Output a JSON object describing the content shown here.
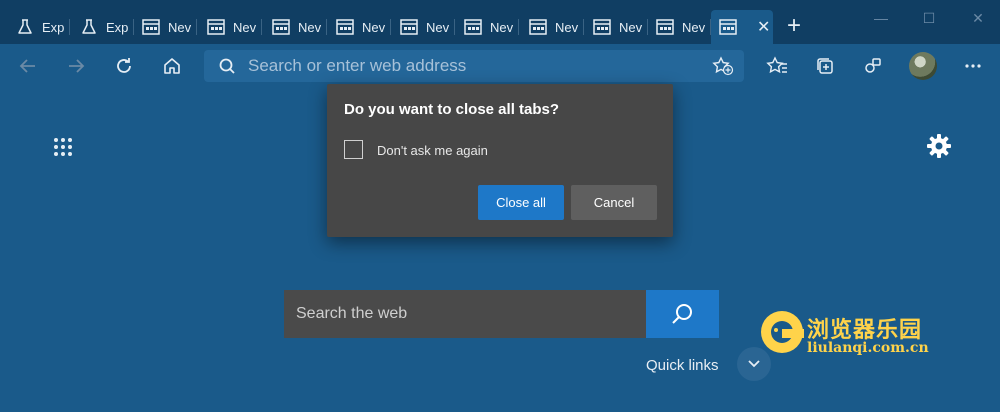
{
  "tabs": [
    {
      "title": "Exp",
      "icon": "flask-icon"
    },
    {
      "title": "Exp",
      "icon": "flask-icon"
    },
    {
      "title": "Nev",
      "icon": "new-tab-icon"
    },
    {
      "title": "Nev",
      "icon": "new-tab-icon"
    },
    {
      "title": "Nev",
      "icon": "new-tab-icon"
    },
    {
      "title": "Nev",
      "icon": "new-tab-icon"
    },
    {
      "title": "Nev",
      "icon": "new-tab-icon"
    },
    {
      "title": "Nev",
      "icon": "new-tab-icon"
    },
    {
      "title": "Nev",
      "icon": "new-tab-icon"
    },
    {
      "title": "Nev",
      "icon": "new-tab-icon"
    },
    {
      "title": "Nev",
      "icon": "new-tab-icon"
    }
  ],
  "window_controls": {
    "minimize": "—",
    "maximize": "☐",
    "close": "✕"
  },
  "address_bar": {
    "placeholder": "Search or enter web address"
  },
  "dialog": {
    "title": "Do you want to close all tabs?",
    "checkbox_label": "Don't ask me again",
    "checkbox_checked": false,
    "primary_button": "Close all",
    "secondary_button": "Cancel"
  },
  "search": {
    "placeholder": "Search the web"
  },
  "quick_links": {
    "label": "Quick links"
  },
  "watermark": {
    "title": "浏览器乐园",
    "url": "liulanqi.com.cn"
  },
  "colors": {
    "background": "#1a5a8a",
    "tabstrip": "#103e63",
    "accent": "#1e78c8",
    "dialog": "#474747"
  }
}
